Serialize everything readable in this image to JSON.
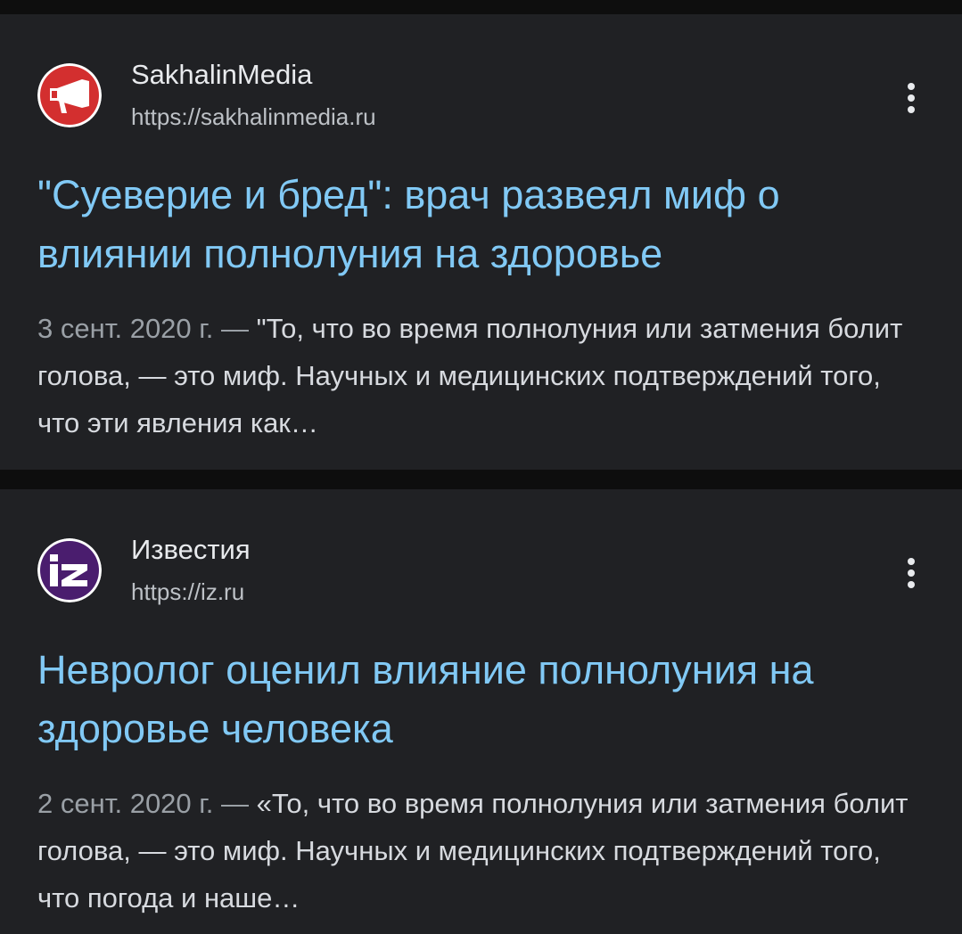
{
  "results": [
    {
      "source": "SakhalinMedia",
      "url": "https://sakhalinmedia.ru",
      "title": "\"Суеверие и бред\": врач развеял миф о влиянии полнолуния на здоровье",
      "date": "3 сент. 2020 г. — ",
      "snippet": "\"То, что во время полнолуния или затмения болит голова, — это миф. Научных и медицинских подтверждений того, что эти явления как…",
      "favicon_icon": "megaphone-icon",
      "favicon_color": "#d32f2f"
    },
    {
      "source": "Известия",
      "url": "https://iz.ru",
      "title": "Невролог оценил влияние полнолуния на здоровье человека",
      "date": "2 сент. 2020 г. — ",
      "snippet": "«То, что во время полнолуния или затмения болит голова, — это миф. Научных и медицинских подтверждений того, что погода и наше…",
      "favicon_icon": "iz-logo-icon",
      "favicon_color": "#4a1d6e"
    }
  ],
  "colors": {
    "background": "#0e0e0e",
    "card": "#202124",
    "title_link": "#81c9f5",
    "text": "#e8eaed",
    "muted": "#9aa0a6"
  }
}
